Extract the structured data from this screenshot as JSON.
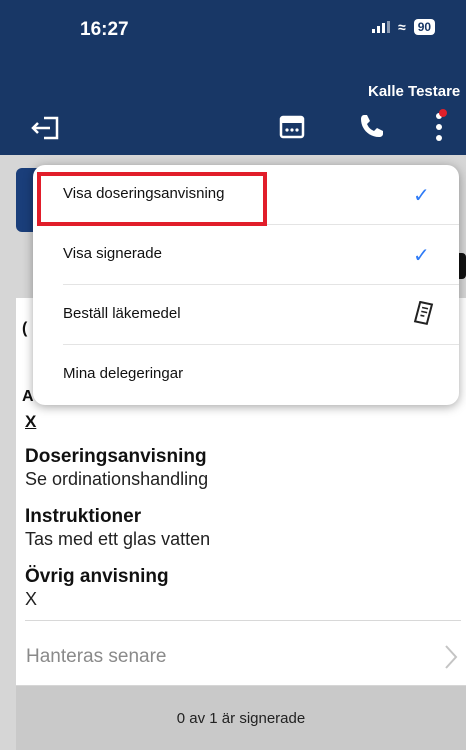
{
  "status": {
    "time": "16:27",
    "battery": "90"
  },
  "header": {
    "user_name": "Kalle Testare"
  },
  "background": {
    "frag1": "(",
    "frag2": "A",
    "x_marker": "X"
  },
  "details": [
    {
      "title": "Doseringsanvisning",
      "value": "Se ordinationshandling"
    },
    {
      "title": "Instruktioner",
      "value": "Tas med ett glas vatten"
    },
    {
      "title": "Övrig anvisning",
      "value": "X"
    }
  ],
  "later": {
    "label": "Hanteras senare"
  },
  "footer": {
    "text": "0 av 1 är signerade"
  },
  "menu": {
    "items": [
      {
        "label": "Visa doseringsanvisning",
        "checked": true
      },
      {
        "label": "Visa signerade",
        "checked": true
      },
      {
        "label": "Beställ läkemedel",
        "icon": "order-form-icon"
      },
      {
        "label": "Mina delegeringar"
      }
    ]
  },
  "colors": {
    "header_bg": "#183766",
    "check": "#2f7bf6",
    "highlight": "#e11d2a",
    "notification_dot": "#e0202a"
  }
}
